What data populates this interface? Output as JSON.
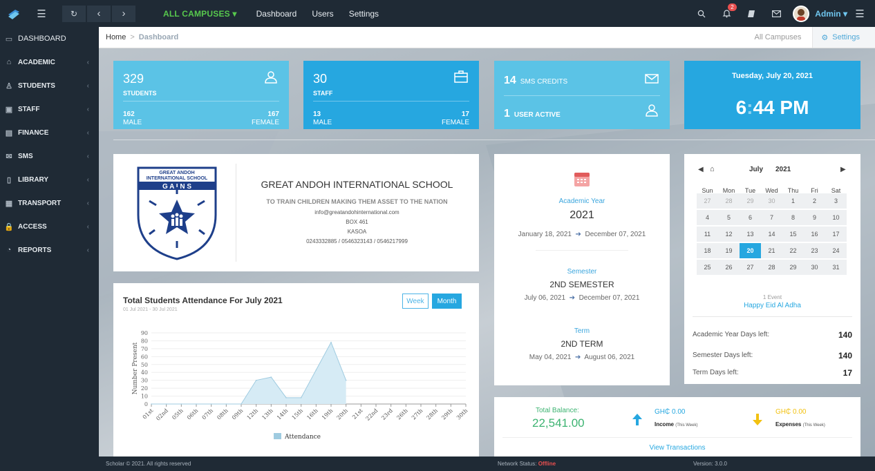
{
  "colors": {
    "dark": "#1f2a35",
    "light_blue": "#5bc3e6",
    "mid_blue": "#26a7e0",
    "accent_green": "#57c84d",
    "offline": "#e84f4f"
  },
  "topbar": {
    "campus": "ALL CAMPUSES",
    "links": [
      "Dashboard",
      "Users",
      "Settings"
    ],
    "notification_count": "2",
    "user": "Admin",
    "icons": [
      "logo-icon",
      "menu-icon",
      "refresh-icon",
      "back-icon",
      "forward-icon",
      "search-icon",
      "bell-icon",
      "book-icon",
      "mail-icon",
      "hamburger-icon"
    ]
  },
  "sidebar": {
    "items": [
      {
        "label": "DASHBOARD",
        "icon": "monitor-icon"
      },
      {
        "label": "ACADEMIC",
        "icon": "graduation-cap-icon"
      },
      {
        "label": "STUDENTS",
        "icon": "user-icon"
      },
      {
        "label": "STAFF",
        "icon": "briefcase-icon"
      },
      {
        "label": "FINANCE",
        "icon": "money-icon"
      },
      {
        "label": "SMS",
        "icon": "envelope-icon"
      },
      {
        "label": "LIBRARY",
        "icon": "book-icon"
      },
      {
        "label": "TRANSPORT",
        "icon": "bus-icon"
      },
      {
        "label": "ACCESS",
        "icon": "lock-icon"
      },
      {
        "label": "REPORTS",
        "icon": "pie-chart-icon"
      }
    ]
  },
  "breadcrumb": {
    "home": "Home",
    "current": "Dashboard",
    "campus": "All Campuses",
    "settings": "Settings"
  },
  "stats": {
    "students": {
      "count": "329",
      "label": "STUDENTS",
      "male": "162",
      "male_label": "MALE",
      "female": "167",
      "female_label": "FEMALE"
    },
    "staff": {
      "count": "30",
      "label": "STAFF",
      "male": "13",
      "male_label": "MALE",
      "female": "17",
      "female_label": "FEMALE"
    },
    "sms": {
      "credits": "14",
      "credits_label": "SMS CREDITS",
      "users": "1",
      "users_label": "USER ACTIVE"
    },
    "clock": {
      "date": "Tuesday, July 20, 2021",
      "hour": "6",
      "minute": "44",
      "ampm": "PM"
    }
  },
  "school": {
    "logo_lines": [
      "GREAT ANDOH",
      "INTERNATIONAL SCHOOL",
      "G A I N S"
    ],
    "name": "GREAT ANDOH INTERNATIONAL SCHOOL",
    "motto": "TO TRAIN CHILDREN MAKING THEM ASSET TO THE NATION",
    "email": "info@greatandohinternational.com",
    "box": "BOX 461",
    "town": "KASOA",
    "phones": "0243332885 / 0546323143 / 0546217999"
  },
  "attendance": {
    "title": "Total Students Attendance For July 2021",
    "range": "01 Jul 2021 - 30 Jul 2021",
    "week_btn": "Week",
    "month_btn": "Month"
  },
  "chart_data": {
    "type": "area",
    "title": "Total Students Attendance For July 2021",
    "ylabel": "Number Present",
    "xlabel": "",
    "ylim": [
      0,
      90
    ],
    "yticks": [
      0,
      10,
      20,
      30,
      40,
      50,
      60,
      70,
      80,
      90
    ],
    "categories": [
      "01st",
      "02nd",
      "05th",
      "06th",
      "07th",
      "08th",
      "09th",
      "12th",
      "13th",
      "14th",
      "15th",
      "16th",
      "19th",
      "20th",
      "21st",
      "22nd",
      "23rd",
      "26th",
      "27th",
      "28th",
      "29th",
      "30th"
    ],
    "series": [
      {
        "name": "Attendance",
        "values": [
          0,
          0,
          0,
          0,
          0,
          0,
          0,
          30,
          34,
          8,
          8,
          43,
          78,
          30,
          null,
          null,
          null,
          null,
          null,
          null,
          null,
          null
        ]
      }
    ],
    "legend": "bottom",
    "grid": true
  },
  "academic": {
    "year_label": "Academic Year",
    "year": "2021",
    "year_start": "January 18, 2021",
    "year_end": "December 07, 2021",
    "sem_label": "Semester",
    "sem": "2ND SEMESTER",
    "sem_start": "July 06, 2021",
    "sem_end": "December 07, 2021",
    "term_label": "Term",
    "term": "2ND TERM",
    "term_start": "May 04, 2021",
    "term_end": "August 06, 2021"
  },
  "calendar": {
    "month": "July",
    "year": "2021",
    "dow": [
      "Sun",
      "Mon",
      "Tue",
      "Wed",
      "Thu",
      "Fri",
      "Sat"
    ],
    "days": [
      "27",
      "28",
      "29",
      "30",
      "1",
      "2",
      "3",
      "4",
      "5",
      "6",
      "7",
      "8",
      "9",
      "10",
      "11",
      "12",
      "13",
      "14",
      "15",
      "16",
      "17",
      "18",
      "19",
      "20",
      "21",
      "22",
      "23",
      "24",
      "25",
      "26",
      "27",
      "28",
      "29",
      "30",
      "31"
    ],
    "today": "20",
    "events_count": "1 Event",
    "event": "Happy Eid Al Adha"
  },
  "days_left": [
    {
      "label": "Academic Year Days left:",
      "value": "140"
    },
    {
      "label": "Semester Days left:",
      "value": "140"
    },
    {
      "label": "Term Days left:",
      "value": "17"
    }
  ],
  "balance": {
    "total_label": "Total Balance:",
    "total": "22,541.00",
    "income_amt": "GH₵ 0.00",
    "income_label": "Income",
    "income_note": "(This Week)",
    "expense_amt": "GH₵ 0.00",
    "expense_label": "Expenses",
    "expense_note": "(This Week)",
    "view": "View Transactions"
  },
  "footer": {
    "copyright": "Scholar © 2021. All rights reserved",
    "status_label": "Network Status:",
    "status": "Offline",
    "version": "Version: 3.0.0"
  }
}
